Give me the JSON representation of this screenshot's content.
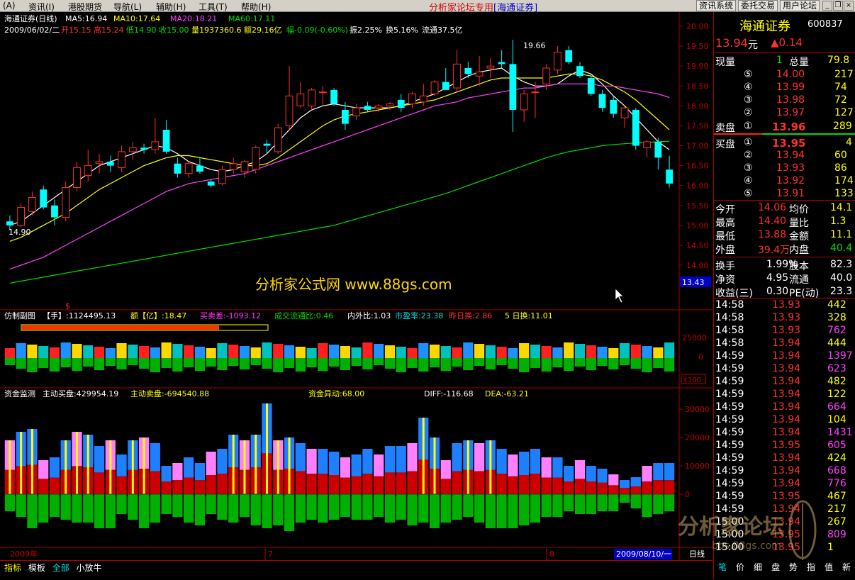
{
  "menu": {
    "items": [
      "(A)",
      "资讯(I)",
      "港股期货",
      "导航(L)",
      "辅助(H)",
      "工具(T)",
      "帮助(H)"
    ],
    "center_title": "分析家论坛专用",
    "broker": "[海通证券]",
    "buttons": [
      "资讯系统",
      "委托交易",
      "用户论坛"
    ]
  },
  "chart": {
    "title": "海通证券(日线)",
    "ma5": "MA5:16.94",
    "ma10": "MA10:17.64",
    "ma20": "MA20:18.21",
    "ma60": "MA60:17.11",
    "info_date": "2009/06/02/二",
    "info_open": "开15.15",
    "info_high": "高15.24",
    "info_low": "低14.90",
    "info_close": "收15.00",
    "info_vol": "量1937360.6",
    "info_amt": "额29.16亿",
    "info_chg": "幅-0.09(-0.60%)",
    "info_amp": "振2.25%",
    "info_turn": "换5.16%",
    "info_float": "流通37.5亿",
    "label_high": "19.66",
    "label_low": "14.90",
    "price_tag": "13.43",
    "watermark": "分析家公式网 www.88gs.com",
    "price_ticks": [
      "20.00",
      "19.50",
      "19.00",
      "18.50",
      "18.00",
      "17.50",
      "17.00",
      "16.50",
      "16.00",
      "15.50",
      "15.00",
      "14.50",
      "14.00"
    ],
    "ind1_name": "仿制副图",
    "ind1_hand": "【手】:1124495.13",
    "ind1_amt": "额【亿】:18.47",
    "ind1_diff": "买卖差:-1093.12",
    "ind1_ratio": "成交流通比:0.46",
    "ind1_inout": "内外比:1.03",
    "ind1_pe": "市盈率:23.38",
    "ind1_yday": "昨日换:2.86",
    "ind1_5day": "5 日换:11.01",
    "ind1_ticks": [
      "25000",
      "0"
    ],
    "ind1_scale": "X100",
    "ind2_name": "资金监测",
    "ind2_buy": "主动买盘:429954.19",
    "ind2_sell": "主动卖盘:-694540.88",
    "ind2_flow": "资金异动:68.00",
    "ind2_diff": "DIFF:-116.68",
    "ind2_dea": "DEA:-63.21",
    "ind2_ticks": [
      "30000",
      "20000",
      "10000",
      "0"
    ],
    "x_labels": [
      "2009年",
      "7",
      "8"
    ],
    "x_date": "2009/08/10/一",
    "period": "日线",
    "tick_marker": "$"
  },
  "chart_data": {
    "type": "candlestick",
    "ylim": [
      13.4,
      20.2
    ],
    "candles": [
      {
        "o": 15.1,
        "h": 15.25,
        "l": 14.9,
        "c": 15.0
      },
      {
        "o": 15.0,
        "h": 15.55,
        "l": 14.95,
        "c": 15.45
      },
      {
        "o": 15.35,
        "h": 15.85,
        "l": 15.25,
        "c": 15.7
      },
      {
        "o": 15.9,
        "h": 16.0,
        "l": 15.4,
        "c": 15.45
      },
      {
        "o": 15.5,
        "h": 15.65,
        "l": 15.0,
        "c": 15.2
      },
      {
        "o": 15.2,
        "h": 16.1,
        "l": 15.1,
        "c": 15.95
      },
      {
        "o": 15.95,
        "h": 16.6,
        "l": 15.85,
        "c": 16.45
      },
      {
        "o": 16.25,
        "h": 16.9,
        "l": 16.1,
        "c": 16.5
      },
      {
        "o": 16.55,
        "h": 16.8,
        "l": 16.3,
        "c": 16.6
      },
      {
        "o": 16.6,
        "h": 16.75,
        "l": 16.35,
        "c": 16.5
      },
      {
        "o": 16.45,
        "h": 17.0,
        "l": 16.35,
        "c": 16.85
      },
      {
        "o": 16.85,
        "h": 17.1,
        "l": 16.65,
        "c": 16.95
      },
      {
        "o": 16.95,
        "h": 17.05,
        "l": 16.8,
        "c": 16.9
      },
      {
        "o": 16.9,
        "h": 17.7,
        "l": 16.8,
        "c": 17.1
      },
      {
        "o": 17.4,
        "h": 17.65,
        "l": 16.8,
        "c": 16.85
      },
      {
        "o": 16.55,
        "h": 16.7,
        "l": 16.2,
        "c": 16.3
      },
      {
        "o": 16.3,
        "h": 16.6,
        "l": 16.2,
        "c": 16.55
      },
      {
        "o": 16.5,
        "h": 16.7,
        "l": 16.3,
        "c": 16.35
      },
      {
        "o": 16.1,
        "h": 16.15,
        "l": 15.95,
        "c": 16.0
      },
      {
        "o": 16.05,
        "h": 16.5,
        "l": 16.0,
        "c": 16.4
      },
      {
        "o": 16.4,
        "h": 16.7,
        "l": 16.3,
        "c": 16.55
      },
      {
        "o": 16.35,
        "h": 16.65,
        "l": 16.2,
        "c": 16.6
      },
      {
        "o": 16.4,
        "h": 17.0,
        "l": 16.3,
        "c": 16.95
      },
      {
        "o": 17.05,
        "h": 17.15,
        "l": 16.8,
        "c": 17.0
      },
      {
        "o": 16.85,
        "h": 17.55,
        "l": 16.8,
        "c": 17.45
      },
      {
        "o": 17.5,
        "h": 19.0,
        "l": 17.4,
        "c": 18.25
      },
      {
        "o": 18.0,
        "h": 18.6,
        "l": 17.95,
        "c": 18.3
      },
      {
        "o": 18.0,
        "h": 18.45,
        "l": 17.9,
        "c": 18.4
      },
      {
        "o": 18.35,
        "h": 18.5,
        "l": 18.0,
        "c": 18.35
      },
      {
        "o": 18.4,
        "h": 18.45,
        "l": 18.0,
        "c": 18.05
      },
      {
        "o": 17.9,
        "h": 18.1,
        "l": 17.4,
        "c": 17.55
      },
      {
        "o": 17.75,
        "h": 18.05,
        "l": 17.65,
        "c": 17.95
      },
      {
        "o": 18.0,
        "h": 18.1,
        "l": 17.85,
        "c": 17.9
      },
      {
        "o": 17.95,
        "h": 18.05,
        "l": 17.85,
        "c": 18.0
      },
      {
        "o": 18.0,
        "h": 18.1,
        "l": 17.9,
        "c": 18.05
      },
      {
        "o": 18.15,
        "h": 18.3,
        "l": 17.85,
        "c": 17.95
      },
      {
        "o": 18.05,
        "h": 18.35,
        "l": 17.95,
        "c": 18.3
      },
      {
        "o": 18.1,
        "h": 18.55,
        "l": 18.0,
        "c": 18.25
      },
      {
        "o": 18.3,
        "h": 18.65,
        "l": 18.25,
        "c": 18.6
      },
      {
        "o": 18.6,
        "h": 18.95,
        "l": 18.5,
        "c": 18.4
      },
      {
        "o": 18.45,
        "h": 19.4,
        "l": 18.35,
        "c": 19.05
      },
      {
        "o": 18.95,
        "h": 19.1,
        "l": 18.7,
        "c": 18.8
      },
      {
        "o": 18.75,
        "h": 19.25,
        "l": 18.5,
        "c": 18.85
      },
      {
        "o": 18.95,
        "h": 19.2,
        "l": 18.7,
        "c": 19.0
      },
      {
        "o": 19.1,
        "h": 19.4,
        "l": 18.95,
        "c": 19.05
      },
      {
        "o": 19.05,
        "h": 19.66,
        "l": 17.35,
        "c": 17.9
      },
      {
        "o": 17.9,
        "h": 18.4,
        "l": 17.6,
        "c": 18.3
      },
      {
        "o": 18.35,
        "h": 18.6,
        "l": 17.7,
        "c": 18.35
      },
      {
        "o": 18.55,
        "h": 19.05,
        "l": 18.4,
        "c": 18.95
      },
      {
        "o": 18.9,
        "h": 19.5,
        "l": 18.8,
        "c": 19.35
      },
      {
        "o": 19.4,
        "h": 19.5,
        "l": 19.05,
        "c": 19.1
      },
      {
        "o": 19.0,
        "h": 19.1,
        "l": 18.7,
        "c": 18.75
      },
      {
        "o": 18.7,
        "h": 18.8,
        "l": 18.25,
        "c": 18.3
      },
      {
        "o": 18.3,
        "h": 18.4,
        "l": 17.85,
        "c": 17.95
      },
      {
        "o": 18.15,
        "h": 18.25,
        "l": 17.7,
        "c": 17.8
      },
      {
        "o": 17.7,
        "h": 18.0,
        "l": 17.45,
        "c": 17.95
      },
      {
        "o": 17.9,
        "h": 17.95,
        "l": 16.9,
        "c": 17.0
      },
      {
        "o": 16.95,
        "h": 17.15,
        "l": 16.7,
        "c": 17.1
      },
      {
        "o": 17.1,
        "h": 17.2,
        "l": 16.4,
        "c": 16.7
      },
      {
        "o": 16.4,
        "h": 16.75,
        "l": 15.95,
        "c": 16.05
      }
    ],
    "series": [
      {
        "name": "MA5",
        "color": "#ffffff",
        "values": [
          15.0,
          15.1,
          15.3,
          15.5,
          15.7,
          15.9,
          16.1,
          16.3,
          16.5,
          16.6,
          16.7,
          16.8,
          16.9,
          17.0,
          16.95,
          16.8,
          16.6,
          16.5,
          16.4,
          16.35,
          16.4,
          16.5,
          16.6,
          16.8,
          17.1,
          17.4,
          17.7,
          17.9,
          18.0,
          18.05,
          18.0,
          17.95,
          17.95,
          17.95,
          17.95,
          18.0,
          18.1,
          18.2,
          18.3,
          18.45,
          18.6,
          18.75,
          18.85,
          18.9,
          18.95,
          18.75,
          18.6,
          18.5,
          18.5,
          18.55,
          18.75,
          18.9,
          18.8,
          18.55,
          18.25,
          18.0,
          17.7,
          17.4,
          17.1,
          16.9
        ]
      },
      {
        "name": "MA10",
        "color": "#ffff00",
        "values": [
          14.6,
          14.7,
          14.85,
          15.0,
          15.15,
          15.3,
          15.5,
          15.7,
          15.9,
          16.05,
          16.2,
          16.35,
          16.5,
          16.6,
          16.7,
          16.75,
          16.75,
          16.7,
          16.65,
          16.6,
          16.55,
          16.5,
          16.5,
          16.55,
          16.7,
          16.9,
          17.1,
          17.3,
          17.5,
          17.65,
          17.75,
          17.8,
          17.85,
          17.9,
          17.95,
          18.0,
          18.05,
          18.1,
          18.15,
          18.25,
          18.35,
          18.45,
          18.55,
          18.65,
          18.7,
          18.7,
          18.7,
          18.7,
          18.7,
          18.75,
          18.8,
          18.8,
          18.75,
          18.65,
          18.5,
          18.35,
          18.15,
          17.9,
          17.65,
          17.4
        ]
      },
      {
        "name": "MA20",
        "color": "#ff40ff",
        "values": [
          13.9,
          14.0,
          14.1,
          14.2,
          14.35,
          14.5,
          14.65,
          14.8,
          14.95,
          15.1,
          15.25,
          15.4,
          15.55,
          15.7,
          15.85,
          15.95,
          16.05,
          16.1,
          16.15,
          16.2,
          16.25,
          16.3,
          16.4,
          16.5,
          16.6,
          16.7,
          16.8,
          16.9,
          17.0,
          17.1,
          17.2,
          17.3,
          17.4,
          17.5,
          17.6,
          17.7,
          17.8,
          17.9,
          18.0,
          18.05,
          18.1,
          18.2,
          18.25,
          18.3,
          18.35,
          18.4,
          18.45,
          18.45,
          18.5,
          18.55,
          18.55,
          18.55,
          18.55,
          18.5,
          18.5,
          18.45,
          18.4,
          18.35,
          18.3,
          18.21
        ]
      },
      {
        "name": "MA60",
        "color": "#00dd00",
        "values": [
          13.55,
          13.6,
          13.65,
          13.7,
          13.75,
          13.8,
          13.85,
          13.9,
          13.95,
          14.0,
          14.05,
          14.1,
          14.15,
          14.2,
          14.25,
          14.3,
          14.35,
          14.4,
          14.45,
          14.5,
          14.55,
          14.6,
          14.65,
          14.7,
          14.75,
          14.8,
          14.85,
          14.9,
          14.95,
          15.0,
          15.08,
          15.16,
          15.24,
          15.32,
          15.4,
          15.48,
          15.56,
          15.64,
          15.72,
          15.8,
          15.9,
          16.0,
          16.1,
          16.2,
          16.3,
          16.4,
          16.5,
          16.6,
          16.7,
          16.78,
          16.85,
          16.9,
          16.95,
          17.0,
          17.03,
          17.05,
          17.07,
          17.08,
          17.1,
          17.11
        ]
      }
    ],
    "ind1": [
      1,
      1,
      1,
      1,
      1,
      1,
      1,
      1,
      1,
      1,
      1,
      1,
      1,
      1,
      1,
      1,
      1,
      1,
      1,
      1,
      1,
      1,
      1,
      1,
      1,
      1,
      1,
      1,
      1,
      1,
      1,
      1,
      1,
      1,
      1,
      1,
      1,
      1,
      1,
      1,
      1,
      1,
      1,
      1,
      1,
      1,
      1,
      1,
      1,
      1,
      1,
      1,
      1,
      1,
      1,
      1,
      1,
      1,
      1,
      1
    ],
    "ind2_pos": [
      19000,
      22000,
      23000,
      12000,
      13000,
      19000,
      22000,
      21000,
      17000,
      19000,
      14000,
      19000,
      20000,
      18000,
      10000,
      11000,
      13000,
      11000,
      15000,
      16000,
      21000,
      19000,
      21000,
      32000,
      19000,
      20000,
      18000,
      16000,
      16000,
      15000,
      13000,
      14000,
      16000,
      14000,
      17000,
      17000,
      18000,
      27000,
      20000,
      12000,
      18000,
      19000,
      18000,
      19000,
      16000,
      14000,
      15000,
      16000,
      13000,
      13000,
      10000,
      12000,
      10000,
      9000,
      7000,
      5000,
      6000,
      10000,
      11000,
      11000
    ],
    "ind2_neg": [
      -6000,
      -8000,
      -12000,
      -10000,
      -8000,
      -9000,
      -10000,
      -10000,
      -12000,
      -12000,
      -7000,
      -9000,
      -12000,
      -10000,
      -7000,
      -8000,
      -10000,
      -11000,
      -7000,
      -9000,
      -10000,
      -8000,
      -11000,
      -12000,
      -11000,
      -13000,
      -10000,
      -9000,
      -10000,
      -9000,
      -8000,
      -9000,
      -9000,
      -8000,
      -10000,
      -9000,
      -11000,
      -10000,
      -12000,
      -10000,
      -9000,
      -8000,
      -10000,
      -12000,
      -12000,
      -12000,
      -11000,
      -10000,
      -8000,
      -8000,
      -6000,
      -7000,
      -7000,
      -6000,
      -6000,
      -3000,
      -5000,
      -8000,
      -7000,
      -6000
    ]
  },
  "quote": {
    "name": "海通证券",
    "code": "600837",
    "price": "13.94",
    "price_unit": "元",
    "change": "▲0.14",
    "now_vol_label": "现量",
    "now_vol": "1",
    "total_vol_label": "总量",
    "total_vol": "79.8",
    "asks": [
      {
        "n": "⑤",
        "p": "14.00",
        "v": "217"
      },
      {
        "n": "④",
        "p": "13.99",
        "v": "74"
      },
      {
        "n": "③",
        "p": "13.98",
        "v": "72"
      },
      {
        "n": "②",
        "p": "13.97",
        "v": "127"
      }
    ],
    "ask1_label": "卖盘",
    "ask1_n": "①",
    "ask1_p": "13.96",
    "ask1_v": "289",
    "bid1_label": "买盘",
    "bid1_n": "①",
    "bid1_p": "13.95",
    "bid1_v": "4",
    "bids": [
      {
        "n": "②",
        "p": "13.94",
        "v": "60"
      },
      {
        "n": "③",
        "p": "13.93",
        "v": "86"
      },
      {
        "n": "④",
        "p": "13.92",
        "v": "174"
      },
      {
        "n": "⑤",
        "p": "13.91",
        "v": "133"
      }
    ],
    "stats": [
      {
        "l1": "今开",
        "v1": "14.06",
        "l2": "均价",
        "v2": "14.1"
      },
      {
        "l1": "最高",
        "v1": "14.40",
        "l2": "量比",
        "v2": "1.3"
      },
      {
        "l1": "最低",
        "v1": "13.88",
        "l2": "金额",
        "v2": "11.1"
      },
      {
        "l1": "外盘",
        "v1": "39.4万",
        "l2": "内盘",
        "v2": "40.4"
      }
    ],
    "stats2": [
      {
        "l1": "换手",
        "v1": "1.99%",
        "l2": "股本",
        "v2": "82.3"
      },
      {
        "l1": "净资",
        "v1": "4.95",
        "l2": "流通",
        "v2": "40.0"
      },
      {
        "l1": "收益(三)",
        "v1": "0.30",
        "l2": "PE(动)",
        "v2": "23.3"
      }
    ],
    "ticks": [
      {
        "t": "14:58",
        "p": "13.93",
        "v": "442",
        "c": "#ffff00"
      },
      {
        "t": "14:58",
        "p": "13.93",
        "v": "328",
        "c": "#ffff00"
      },
      {
        "t": "14:58",
        "p": "13.93",
        "v": "762",
        "c": "#ff40ff"
      },
      {
        "t": "14:58",
        "p": "13.94",
        "v": "444",
        "c": "#ffff00"
      },
      {
        "t": "14:59",
        "p": "13.94",
        "v": "1397",
        "c": "#ff40ff"
      },
      {
        "t": "14:59",
        "p": "13.94",
        "v": "623",
        "c": "#ff40ff"
      },
      {
        "t": "14:59",
        "p": "13.94",
        "v": "482",
        "c": "#ffff00"
      },
      {
        "t": "14:59",
        "p": "13.94",
        "v": "122",
        "c": "#ffff00"
      },
      {
        "t": "14:59",
        "p": "13.94",
        "v": "664",
        "c": "#ff40ff"
      },
      {
        "t": "14:59",
        "p": "13.94",
        "v": "104",
        "c": "#ffff00"
      },
      {
        "t": "14:59",
        "p": "13.94",
        "v": "1431",
        "c": "#ff40ff"
      },
      {
        "t": "14:59",
        "p": "13.95",
        "v": "605",
        "c": "#ff40ff"
      },
      {
        "t": "14:59",
        "p": "13.94",
        "v": "424",
        "c": "#ffff00"
      },
      {
        "t": "14:59",
        "p": "13.94",
        "v": "668",
        "c": "#ff40ff"
      },
      {
        "t": "14:59",
        "p": "13.94",
        "v": "776",
        "c": "#ff40ff"
      },
      {
        "t": "14:59",
        "p": "13.95",
        "v": "467",
        "c": "#ffff00"
      },
      {
        "t": "14:59",
        "p": "13.94",
        "v": "217",
        "c": "#ffff00"
      },
      {
        "t": "15:00",
        "p": "13.94",
        "v": "267",
        "c": "#ffff00"
      },
      {
        "t": "15:00",
        "p": "13.95",
        "v": "809",
        "c": "#ff40ff"
      },
      {
        "t": "15:00",
        "p": "13.95",
        "v": "1",
        "c": "#ffff00"
      }
    ],
    "bottom_tabs": [
      "笔",
      "价",
      "细",
      "盘",
      "势",
      "指",
      "值",
      "新"
    ]
  },
  "bottom": {
    "tabs": [
      "指标",
      "模板",
      "全部",
      "小放牛"
    ]
  },
  "stamp": {
    "text": "分析家论坛",
    "url": "bbs.88gs.com"
  }
}
